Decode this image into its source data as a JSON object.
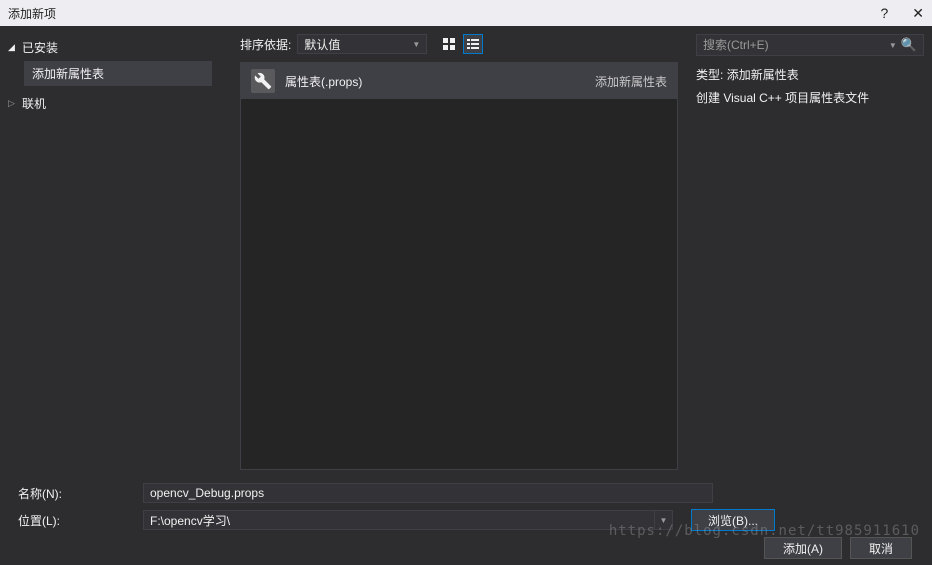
{
  "titlebar": {
    "title": "添加新项",
    "help": "?",
    "close": "✕"
  },
  "sidebar": {
    "installed": "已安装",
    "propSheet": "添加新属性表",
    "online": "联机"
  },
  "sort": {
    "label": "排序依据:",
    "value": "默认值"
  },
  "item": {
    "name": "属性表(.props)",
    "type": "添加新属性表"
  },
  "search": {
    "placeholder": "搜索(Ctrl+E)"
  },
  "info": {
    "typeLabel": "类型:",
    "typeValue": "添加新属性表",
    "desc": "创建 Visual C++ 项目属性表文件"
  },
  "form": {
    "nameLabel": "名称(N):",
    "nameValue": "opencv_Debug.props",
    "locLabel": "位置(L):",
    "locValue": "F:\\opencv学习\\",
    "browse": "浏览(B)..."
  },
  "actions": {
    "add": "添加(A)",
    "cancel": "取消"
  },
  "watermark": "https://blog.csdn.net/tt985911610"
}
